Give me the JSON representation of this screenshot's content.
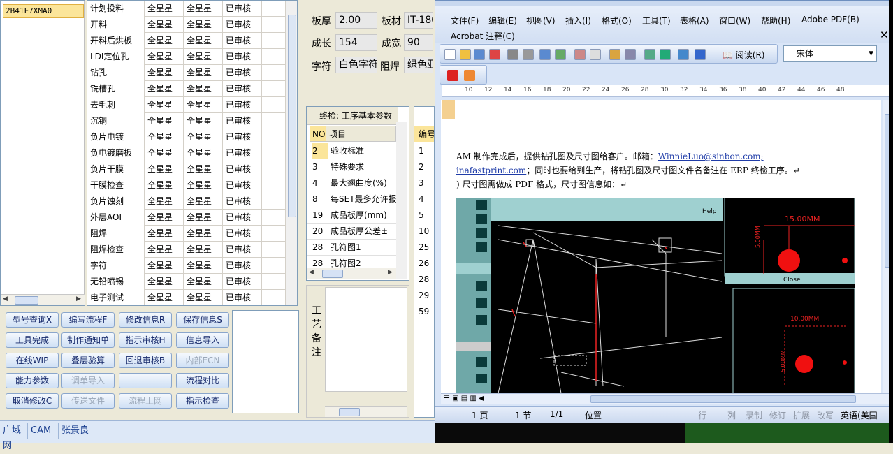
{
  "job_list": {
    "selected": "2B41F7XMA0"
  },
  "process_grid": {
    "rows": [
      {
        "name": "计划投料",
        "c2": "全星星",
        "c3": "全星星",
        "c4": "已审核"
      },
      {
        "name": "开料",
        "c2": "全星星",
        "c3": "全星星",
        "c4": "已审核"
      },
      {
        "name": "开料后烘板",
        "c2": "全星星",
        "c3": "全星星",
        "c4": "已审核"
      },
      {
        "name": "LDI定位孔",
        "c2": "全星星",
        "c3": "全星星",
        "c4": "已审核"
      },
      {
        "name": "钻孔",
        "c2": "全星星",
        "c3": "全星星",
        "c4": "已审核"
      },
      {
        "name": "铣槽孔",
        "c2": "全星星",
        "c3": "全星星",
        "c4": "已审核"
      },
      {
        "name": "去毛刺",
        "c2": "全星星",
        "c3": "全星星",
        "c4": "已审核"
      },
      {
        "name": "沉铜",
        "c2": "全星星",
        "c3": "全星星",
        "c4": "已审核"
      },
      {
        "name": "负片电镀",
        "c2": "全星星",
        "c3": "全星星",
        "c4": "已审核"
      },
      {
        "name": "负电镀磨板",
        "c2": "全星星",
        "c3": "全星星",
        "c4": "已审核"
      },
      {
        "name": "负片干膜",
        "c2": "全星星",
        "c3": "全星星",
        "c4": "已审核"
      },
      {
        "name": "干膜检查",
        "c2": "全星星",
        "c3": "全星星",
        "c4": "已审核"
      },
      {
        "name": "负片蚀刻",
        "c2": "全星星",
        "c3": "全星星",
        "c4": "已审核"
      },
      {
        "name": "外层AOI",
        "c2": "全星星",
        "c3": "全星星",
        "c4": "已审核"
      },
      {
        "name": "阻焊",
        "c2": "全星星",
        "c3": "全星星",
        "c4": "已审核"
      },
      {
        "name": "阻焊检查",
        "c2": "全星星",
        "c3": "全星星",
        "c4": "已审核"
      },
      {
        "name": "字符",
        "c2": "全星星",
        "c3": "全星星",
        "c4": "已审核"
      },
      {
        "name": "无铅喷锡",
        "c2": "全星星",
        "c3": "全星星",
        "c4": "已审核"
      },
      {
        "name": "电子测试",
        "c2": "全星星",
        "c3": "全星星",
        "c4": "已审核"
      }
    ]
  },
  "buttons": [
    [
      "型号查询X",
      "编写流程F",
      "修改信息R",
      "保存信息S"
    ],
    [
      "工具完成",
      "制作通知单",
      "指示审核H",
      "信息导入"
    ],
    [
      "在线WIP",
      "叠层验算",
      "回退审核B",
      "内部ECN"
    ],
    [
      "能力参数",
      "调单导入",
      "",
      "流程对比"
    ],
    [
      "取消修改C",
      "传送文件",
      "流程上网",
      "指示检查"
    ]
  ],
  "disabled_buttons": [
    "内部ECN",
    "调单导入",
    "传送文件",
    "流程上网"
  ],
  "detail": {
    "board_thickness_label": "板厚",
    "board_thickness": "2.00",
    "material_label": "板材",
    "material": "IT-180",
    "length_label": "成长",
    "length": "154",
    "width_label": "成宽",
    "width": "90",
    "char_label": "字符",
    "char": "白色字符",
    "mask_label": "阻焊",
    "mask": "绿色亚"
  },
  "final_inspection": {
    "caption": "终检: 工序基本参数",
    "headers": [
      "NO",
      "项目"
    ],
    "rows": [
      [
        "2",
        "验收标准"
      ],
      [
        "3",
        "特殊要求"
      ],
      [
        "4",
        "最大翘曲度(%)"
      ],
      [
        "8",
        "每SET最多允许报"
      ],
      [
        "19",
        "成品板厚(mm)"
      ],
      [
        "20",
        "成品板厚公差±"
      ],
      [
        "28",
        "孔符图1"
      ],
      [
        "28",
        "孔符图2"
      ]
    ]
  },
  "remark": {
    "label_chars": [
      "工",
      "艺",
      "备",
      "注"
    ]
  },
  "grid2": {
    "header": "编号",
    "values": [
      "1",
      "2",
      "3",
      "4",
      "5",
      "10",
      "25",
      "26",
      "28",
      "29",
      "59"
    ]
  },
  "status_bar": [
    "广域网",
    "CAM",
    "张景良"
  ],
  "word": {
    "menu": [
      "文件(F)",
      "编辑(E)",
      "视图(V)",
      "插入(I)",
      "格式(O)",
      "工具(T)",
      "表格(A)",
      "窗口(W)",
      "帮助(H)",
      "Adobe PDF(B)"
    ],
    "menu2": "Acrobat 注释(C)",
    "read_label": "阅读(R)",
    "font_name": "宋体",
    "ruler_ticks": [
      "10",
      "12",
      "14",
      "16",
      "18",
      "20",
      "22",
      "24",
      "26",
      "28",
      "30",
      "32",
      "34",
      "36",
      "38",
      "40",
      "42",
      "44",
      "46",
      "48"
    ],
    "line1_pre": "AM 制作完成后，提供钻孔图及尺寸图给客户。邮箱：",
    "line1_link": "WinnieLuo@sinbon.com;",
    "line2_link": "inafastprint.com",
    "line2_post": "；同时也要给到生产，将钻孔图及尺寸图文件名备注在 ERP 终检工序。↵",
    "line3": ")  尺寸图需做成 PDF 格式，尺寸图信息如：↵",
    "cad": {
      "help": "Help",
      "close": "Close",
      "dim1": "15.00MM",
      "dim2": "5.00MM",
      "dim3": "10.00MM",
      "dim4": "5.00MM"
    },
    "status": {
      "page": "1 页",
      "section": "1 节",
      "pages": "1/1",
      "pos": "位置",
      "row": "行",
      "col": "列",
      "rec": "录制",
      "trk": "修订",
      "ext": "扩展",
      "ovr": "改写",
      "lang": "英语(美国"
    }
  }
}
